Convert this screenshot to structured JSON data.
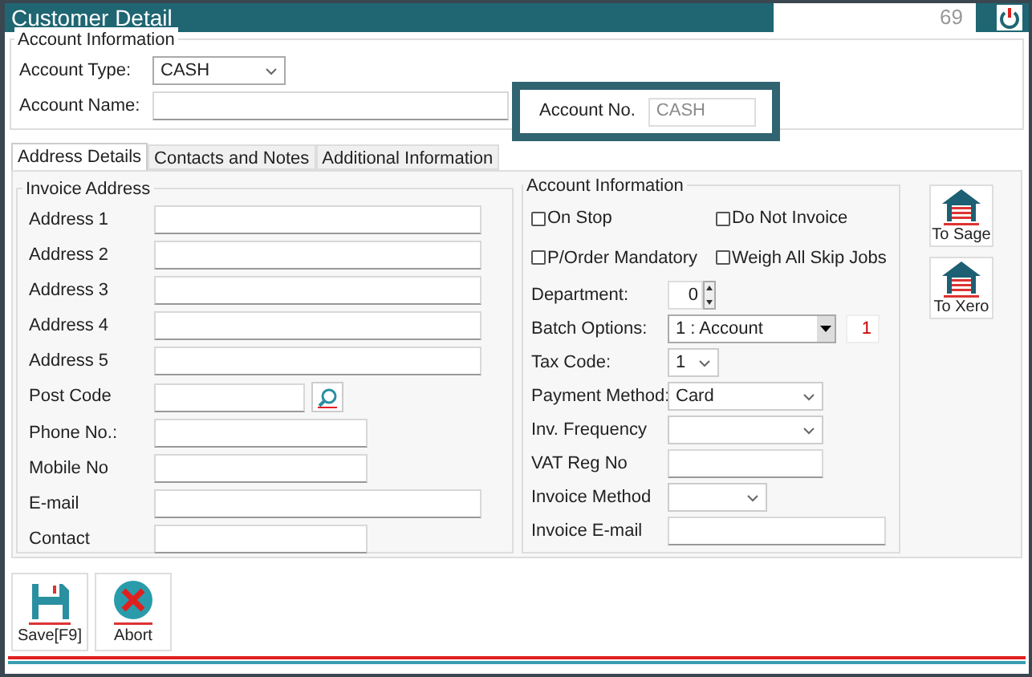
{
  "window": {
    "title": "Customer Detail",
    "counter": "69"
  },
  "account_info": {
    "legend": "Account Information",
    "account_type": {
      "label": "Account Type:",
      "value": "CASH"
    },
    "account_name": {
      "label": "Account Name:"
    },
    "account_no": {
      "label": "Account No.",
      "value": "CASH"
    }
  },
  "tabs": [
    {
      "label": "Address Details",
      "selected": true
    },
    {
      "label": "Contacts and Notes",
      "selected": false
    },
    {
      "label": "Additional Information",
      "selected": false
    }
  ],
  "invoice_address": {
    "legend": "Invoice Address",
    "fields": [
      {
        "label": "Address 1",
        "kind": "wide"
      },
      {
        "label": "Address 2",
        "kind": "wide"
      },
      {
        "label": "Address 3",
        "kind": "wide"
      },
      {
        "label": "Address 4",
        "kind": "wide"
      },
      {
        "label": "Address 5",
        "kind": "wide"
      },
      {
        "label": "Post Code",
        "kind": "postcode"
      },
      {
        "label": "Phone No.:",
        "kind": "narrow"
      },
      {
        "label": "Mobile No",
        "kind": "narrow"
      },
      {
        "label": "E-mail",
        "kind": "wide"
      },
      {
        "label": "Contact",
        "kind": "narrow"
      }
    ]
  },
  "account_panel": {
    "legend": "Account Information",
    "checkboxes": [
      {
        "label": "On Stop",
        "checked": false
      },
      {
        "label": "Do Not Invoice",
        "checked": false
      },
      {
        "label": "P/Order Mandatory",
        "checked": false
      },
      {
        "label": "Weigh All Skip Jobs",
        "checked": false
      }
    ],
    "fields": [
      {
        "label": "Department:",
        "kind": "spinner",
        "value": "0"
      },
      {
        "label": "Batch Options:",
        "kind": "batch",
        "value": "1 : Account",
        "extra": "1"
      },
      {
        "label": "Tax Code:",
        "kind": "select",
        "value": "1"
      },
      {
        "label": "Payment Method:",
        "kind": "select",
        "value": "Card"
      },
      {
        "label": "Inv. Frequency",
        "kind": "select"
      },
      {
        "label": "VAT Reg No",
        "kind": "text"
      },
      {
        "label": "Invoice Method",
        "kind": "select"
      },
      {
        "label": "Invoice E-mail",
        "kind": "text"
      }
    ]
  },
  "side_buttons": [
    {
      "label": "To Sage"
    },
    {
      "label": "To Xero"
    }
  ],
  "bottom_buttons": [
    {
      "label": "Save[F9]",
      "kind": "save"
    },
    {
      "label": "Abort",
      "kind": "abort"
    }
  ]
}
